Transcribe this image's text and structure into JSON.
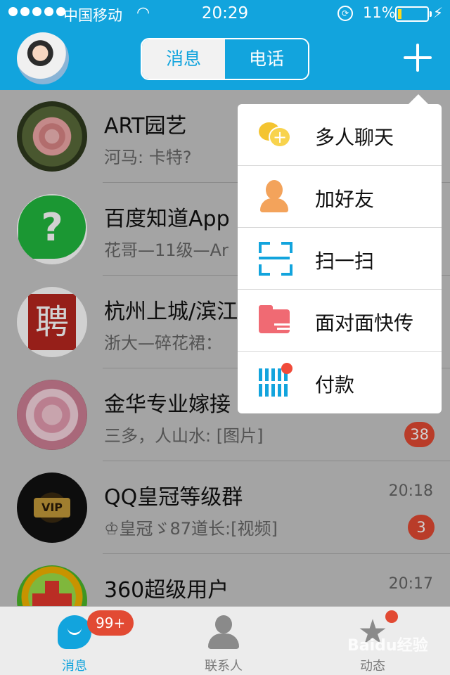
{
  "status_bar": {
    "carrier": "中国移动",
    "time": "20:29",
    "battery_percent": "11%",
    "battery_level": 0.11
  },
  "header": {
    "tabs": [
      {
        "label": "消息",
        "active": true
      },
      {
        "label": "电话",
        "active": false
      }
    ],
    "plus_icon": "plus-icon"
  },
  "conversations": [
    {
      "name": "ART园艺",
      "message": "河马: 卡特?",
      "time": "",
      "badge": ""
    },
    {
      "name": "百度知道App",
      "message": "花哥—11级—Ar",
      "time": "",
      "badge": ""
    },
    {
      "name": "杭州上城/滨江",
      "message": "浙大—碎花裙：",
      "time": "",
      "badge": ""
    },
    {
      "name": "金华专业嫁接",
      "message": "三多，人山水: [图片]",
      "time": "",
      "badge": "38"
    },
    {
      "name": "QQ皇冠等级群",
      "message": "♔皇冠ゞ87道长:[视频]",
      "time": "20:18",
      "badge": "3"
    },
    {
      "name": "360超级用户",
      "message": "",
      "time": "20:17",
      "badge": ""
    }
  ],
  "menu": {
    "items": [
      {
        "label": "多人聊天",
        "icon": "group-chat-icon"
      },
      {
        "label": "加好友",
        "icon": "add-friend-icon"
      },
      {
        "label": "扫一扫",
        "icon": "scan-icon"
      },
      {
        "label": "面对面快传",
        "icon": "folder-transfer-icon"
      },
      {
        "label": "付款",
        "icon": "payment-icon"
      }
    ]
  },
  "tabbar": {
    "tabs": [
      {
        "label": "消息",
        "active": true,
        "badge": "99+"
      },
      {
        "label": "联系人",
        "active": false
      },
      {
        "label": "动态",
        "active": false,
        "dot": true
      }
    ]
  },
  "watermark": "Baidu经验",
  "colors": {
    "primary": "#12a4dd",
    "badge": "#e24a33"
  }
}
